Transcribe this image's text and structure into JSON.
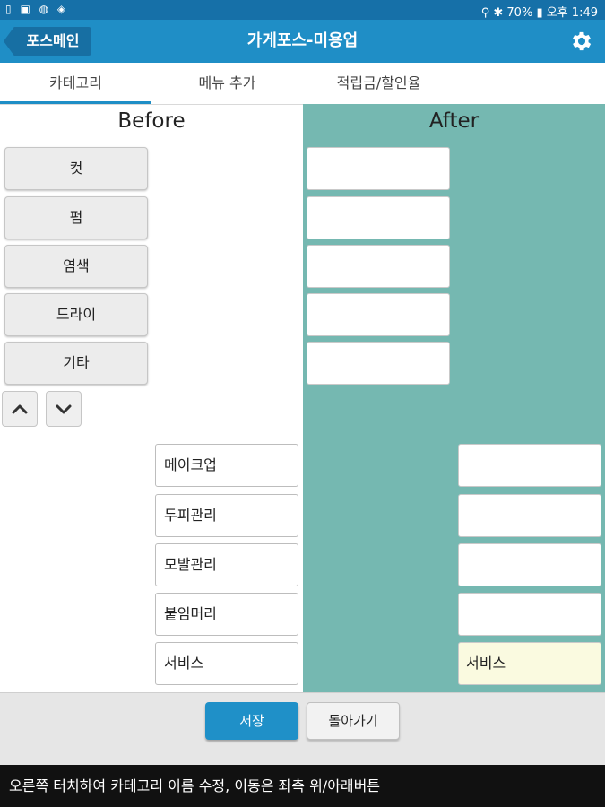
{
  "status_bar": {
    "left_icons": [
      "file-icon",
      "image-icon",
      "circle-icon",
      "box-icon"
    ],
    "battery_percent": "70%",
    "time": "오후 1:49"
  },
  "app_bar": {
    "back_label": "포스메인",
    "title": "가게포스-미용업",
    "settings_icon": "gear-icon",
    "background_color": "#1f8ec6"
  },
  "tabs": [
    {
      "label": "카테고리",
      "active": true
    },
    {
      "label": "메뉴 추가",
      "active": false
    },
    {
      "label": "적립금/할인율",
      "active": false
    }
  ],
  "before": {
    "heading": "Before",
    "categories": [
      "컷",
      "펌",
      "염색",
      "드라이",
      "기타"
    ],
    "up_icon": "chevron-up-icon",
    "down_icon": "chevron-down-icon",
    "sub_items": [
      "메이크업",
      "두피관리",
      "모발관리",
      "붙임머리",
      "서비스"
    ]
  },
  "after": {
    "heading": "After",
    "panel_color": "#75b8b1",
    "categories": [
      "",
      "",
      "",
      "",
      ""
    ],
    "sub_items": [
      "",
      "",
      "",
      "",
      "서비스"
    ]
  },
  "footer": {
    "save_label": "저장",
    "back_label": "돌아가기"
  },
  "bottom_message": "오른쪽 터치하여 카테고리 이름 수정, 이동은 좌측 위/아래버튼"
}
